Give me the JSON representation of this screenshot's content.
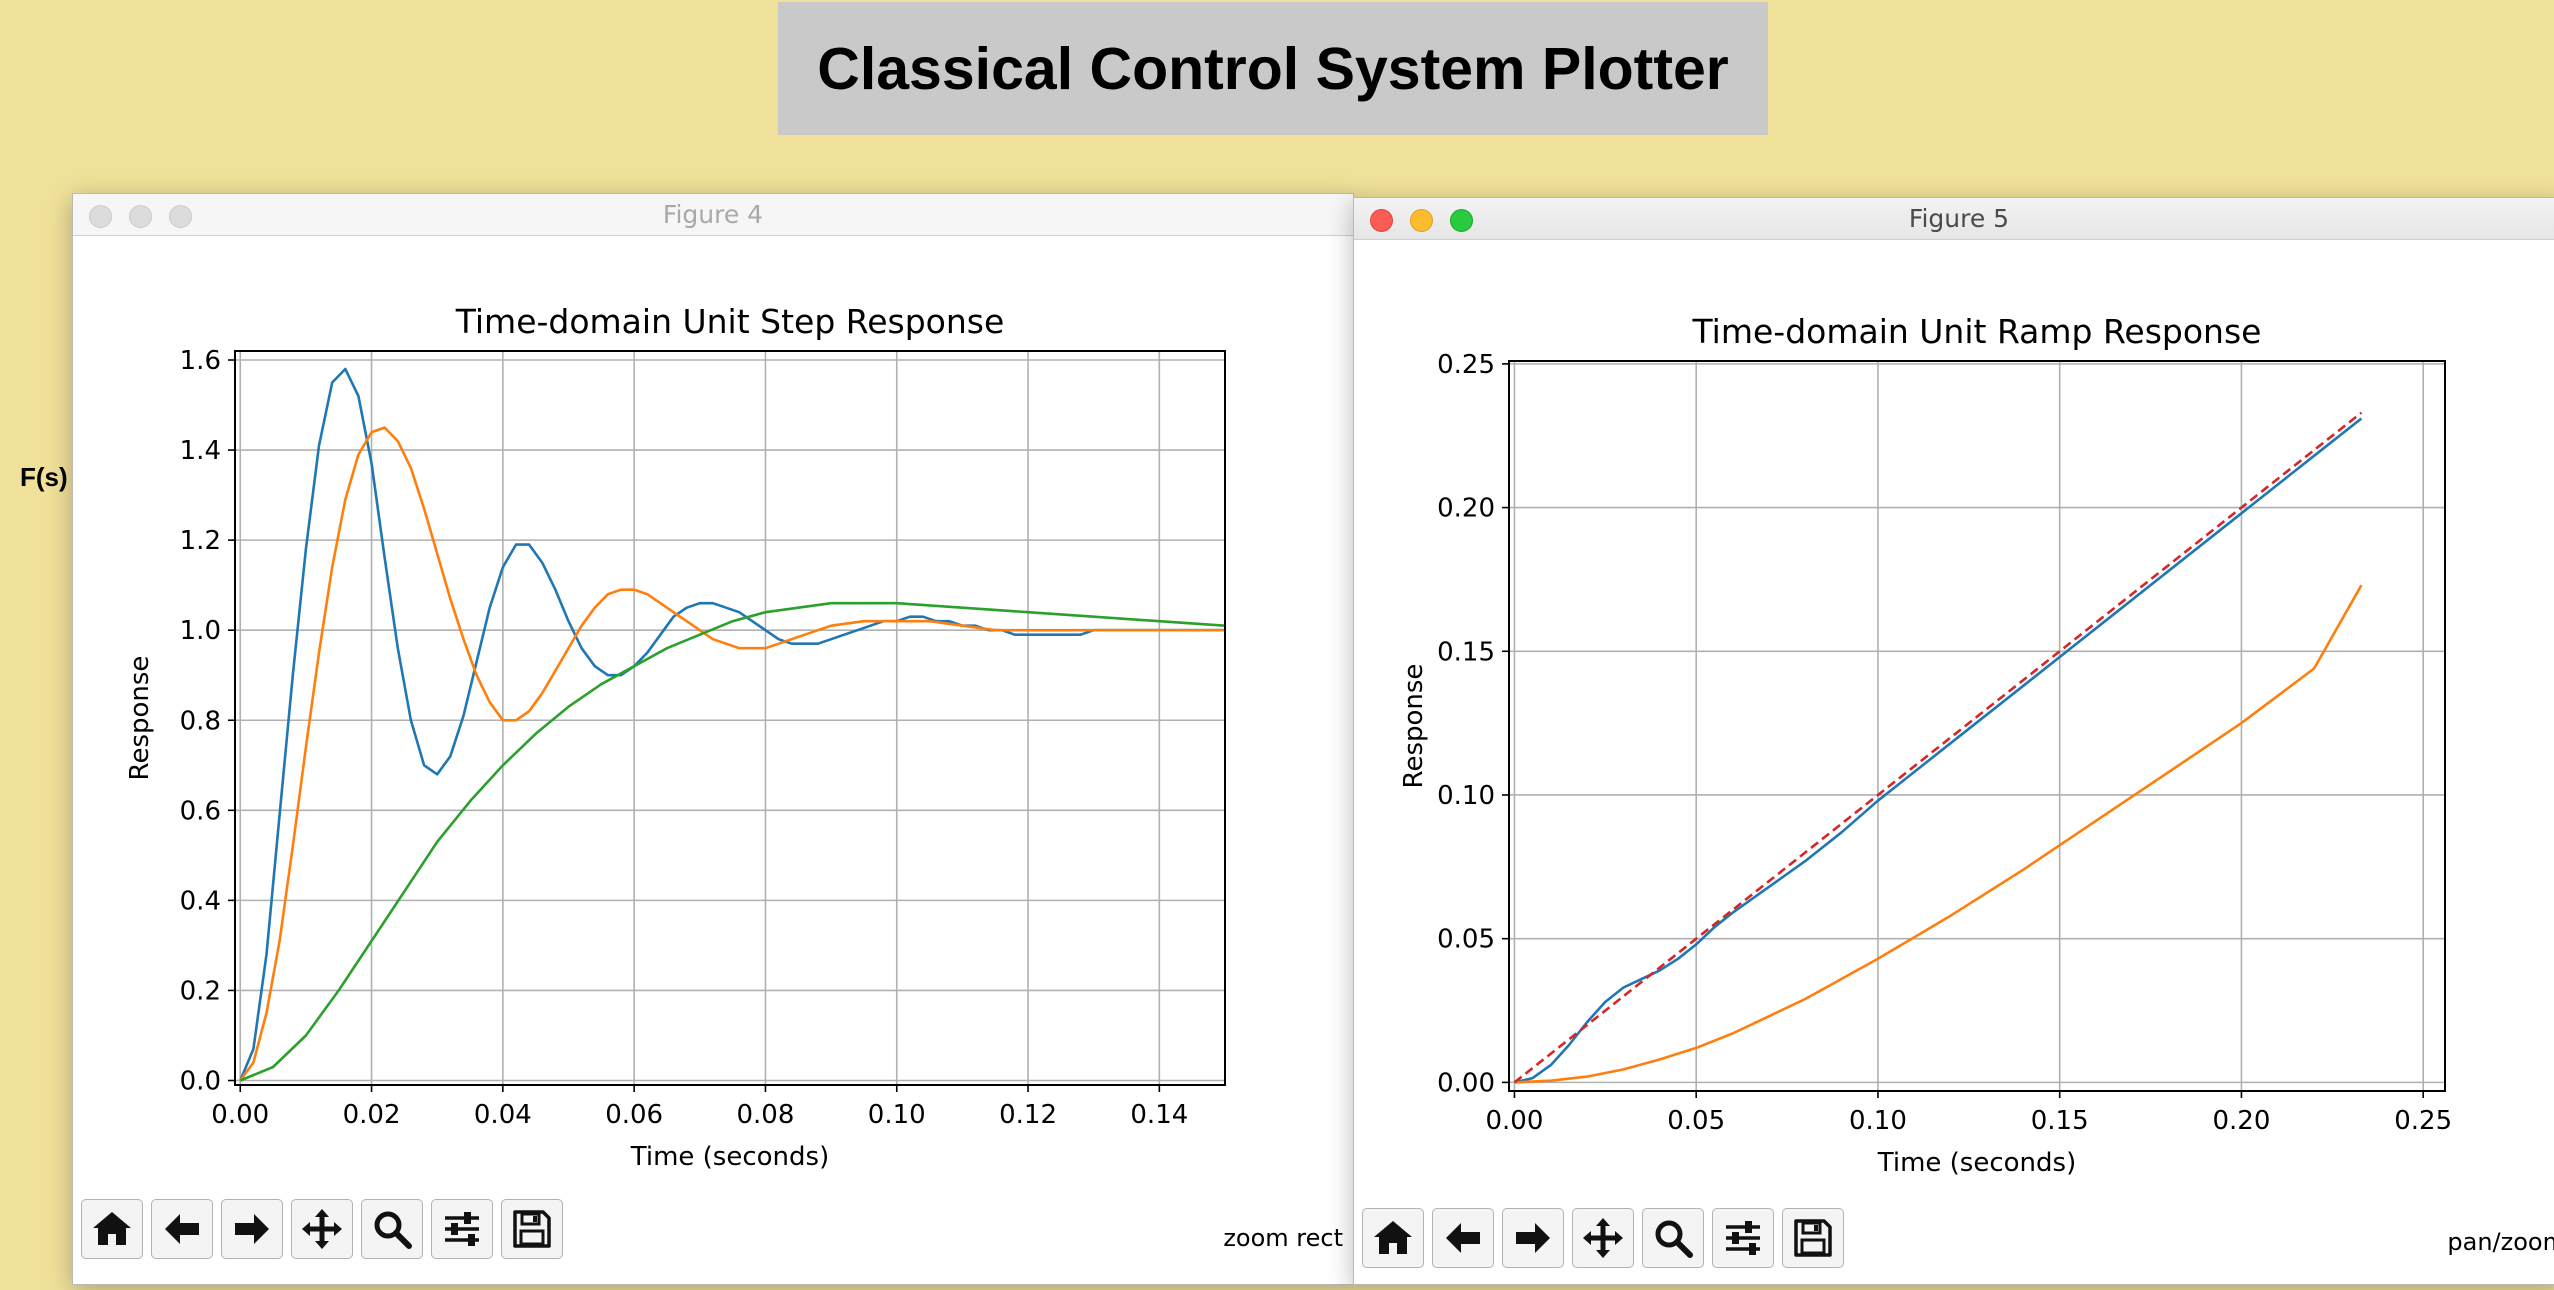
{
  "app": {
    "title": "Classical Control System Plotter",
    "side_label": "F(s)",
    "side_mark": "("
  },
  "figures": [
    {
      "window_title": "Figure 4",
      "mode_text": "zoom rect",
      "active": false
    },
    {
      "window_title": "Figure 5",
      "mode_text": "pan/zoom",
      "active": true
    }
  ],
  "toolbar": {
    "buttons": [
      {
        "name": "home-button",
        "icon": "home-icon"
      },
      {
        "name": "back-button",
        "icon": "arrow-left-icon"
      },
      {
        "name": "forward-button",
        "icon": "arrow-right-icon"
      },
      {
        "name": "pan-button",
        "icon": "move-arrows-icon"
      },
      {
        "name": "zoom-button",
        "icon": "magnifier-icon"
      },
      {
        "name": "configure-subplots-button",
        "icon": "sliders-icon"
      },
      {
        "name": "save-button",
        "icon": "floppy-disk-icon"
      }
    ]
  },
  "colors": {
    "series1": "#1f77b4",
    "series2": "#ff7f0e",
    "series3": "#2ca02c",
    "reference": "#d62728",
    "background": "#f0e19a"
  },
  "chart_data": [
    {
      "type": "line",
      "title": "Time-domain Unit Step Response",
      "xlabel": "Time (seconds)",
      "ylabel": "Response",
      "xlim": [
        -0.0008,
        0.15
      ],
      "ylim": [
        -0.01,
        1.62
      ],
      "xticks": [
        0.0,
        0.02,
        0.04,
        0.06,
        0.08,
        0.1,
        0.12,
        0.14
      ],
      "xtick_labels": [
        "0.00",
        "0.02",
        "0.04",
        "0.06",
        "0.08",
        "0.10",
        "0.12",
        "0.14"
      ],
      "yticks": [
        0.0,
        0.2,
        0.4,
        0.6,
        0.8,
        1.0,
        1.2,
        1.4,
        1.6
      ],
      "ytick_labels": [
        "0.0",
        "0.2",
        "0.4",
        "0.6",
        "0.8",
        "1.0",
        "1.2",
        "1.4",
        "1.6"
      ],
      "grid": true,
      "series": [
        {
          "color": "#1f77b4",
          "dashed": false,
          "x": [
            0,
            0.002,
            0.004,
            0.006,
            0.008,
            0.01,
            0.012,
            0.014,
            0.016,
            0.018,
            0.02,
            0.022,
            0.024,
            0.026,
            0.028,
            0.03,
            0.032,
            0.034,
            0.036,
            0.038,
            0.04,
            0.042,
            0.044,
            0.046,
            0.048,
            0.05,
            0.052,
            0.054,
            0.056,
            0.058,
            0.06,
            0.062,
            0.064,
            0.066,
            0.068,
            0.07,
            0.072,
            0.074,
            0.076,
            0.078,
            0.08,
            0.082,
            0.084,
            0.086,
            0.088,
            0.09,
            0.092,
            0.094,
            0.096,
            0.098,
            0.1,
            0.102,
            0.104,
            0.106,
            0.108,
            0.11,
            0.112,
            0.114,
            0.116,
            0.118,
            0.12,
            0.122,
            0.124,
            0.126,
            0.128,
            0.13,
            0.132,
            0.134,
            0.136,
            0.138,
            0.14,
            0.142,
            0.144,
            0.146,
            0.148,
            0.15
          ],
          "y": [
            0.0,
            0.07,
            0.28,
            0.59,
            0.9,
            1.18,
            1.41,
            1.55,
            1.58,
            1.52,
            1.37,
            1.16,
            0.96,
            0.8,
            0.7,
            0.68,
            0.72,
            0.81,
            0.93,
            1.05,
            1.14,
            1.19,
            1.19,
            1.15,
            1.09,
            1.02,
            0.96,
            0.92,
            0.9,
            0.9,
            0.92,
            0.95,
            0.99,
            1.03,
            1.05,
            1.06,
            1.06,
            1.05,
            1.04,
            1.02,
            1.0,
            0.98,
            0.97,
            0.97,
            0.97,
            0.98,
            0.99,
            1.0,
            1.01,
            1.02,
            1.02,
            1.03,
            1.03,
            1.02,
            1.02,
            1.01,
            1.01,
            1.0,
            1.0,
            0.99,
            0.99,
            0.99,
            0.99,
            0.99,
            0.99,
            1.0,
            1.0,
            1.0,
            1.0,
            1.0,
            1.0,
            1.0,
            1.0,
            1.0,
            1.0,
            1.0
          ]
        },
        {
          "color": "#ff7f0e",
          "dashed": false,
          "x": [
            0,
            0.002,
            0.004,
            0.006,
            0.008,
            0.01,
            0.012,
            0.014,
            0.016,
            0.018,
            0.02,
            0.022,
            0.024,
            0.026,
            0.028,
            0.03,
            0.032,
            0.034,
            0.036,
            0.038,
            0.04,
            0.042,
            0.044,
            0.046,
            0.048,
            0.05,
            0.052,
            0.054,
            0.056,
            0.058,
            0.06,
            0.062,
            0.064,
            0.066,
            0.068,
            0.07,
            0.072,
            0.074,
            0.076,
            0.078,
            0.08,
            0.082,
            0.084,
            0.086,
            0.088,
            0.09,
            0.095,
            0.1,
            0.105,
            0.11,
            0.115,
            0.12,
            0.125,
            0.13,
            0.135,
            0.14,
            0.145,
            0.15
          ],
          "y": [
            0.0,
            0.04,
            0.15,
            0.31,
            0.52,
            0.74,
            0.95,
            1.14,
            1.29,
            1.39,
            1.44,
            1.45,
            1.42,
            1.36,
            1.27,
            1.17,
            1.07,
            0.98,
            0.9,
            0.84,
            0.8,
            0.8,
            0.82,
            0.86,
            0.91,
            0.96,
            1.01,
            1.05,
            1.08,
            1.09,
            1.09,
            1.08,
            1.06,
            1.04,
            1.02,
            1.0,
            0.98,
            0.97,
            0.96,
            0.96,
            0.96,
            0.97,
            0.98,
            0.99,
            1.0,
            1.01,
            1.02,
            1.02,
            1.02,
            1.01,
            1.0,
            1.0,
            1.0,
            1.0,
            1.0,
            1.0,
            1.0,
            1.0
          ]
        },
        {
          "color": "#2ca02c",
          "dashed": false,
          "x": [
            0,
            0.005,
            0.01,
            0.015,
            0.02,
            0.025,
            0.03,
            0.035,
            0.04,
            0.045,
            0.05,
            0.055,
            0.06,
            0.065,
            0.07,
            0.075,
            0.08,
            0.085,
            0.09,
            0.095,
            0.1,
            0.11,
            0.12,
            0.13,
            0.14,
            0.15
          ],
          "y": [
            0.0,
            0.03,
            0.1,
            0.2,
            0.31,
            0.42,
            0.53,
            0.62,
            0.7,
            0.77,
            0.83,
            0.88,
            0.92,
            0.96,
            0.99,
            1.02,
            1.04,
            1.05,
            1.06,
            1.06,
            1.06,
            1.05,
            1.04,
            1.03,
            1.02,
            1.01
          ]
        }
      ]
    },
    {
      "type": "line",
      "title": "Time-domain Unit Ramp Response",
      "xlabel": "Time (seconds)",
      "ylabel": "Response",
      "xlim": [
        -0.0015,
        0.256
      ],
      "ylim": [
        -0.003,
        0.251
      ],
      "xticks": [
        0.0,
        0.05,
        0.1,
        0.15,
        0.2,
        0.25
      ],
      "xtick_labels": [
        "0.00",
        "0.05",
        "0.10",
        "0.15",
        "0.20",
        "0.25"
      ],
      "yticks": [
        0.0,
        0.05,
        0.1,
        0.15,
        0.2,
        0.25
      ],
      "ytick_labels": [
        "0.00",
        "0.05",
        "0.10",
        "0.15",
        "0.20",
        "0.25"
      ],
      "grid": true,
      "series": [
        {
          "color": "#1f77b4",
          "dashed": false,
          "x": [
            0,
            0.005,
            0.01,
            0.015,
            0.02,
            0.025,
            0.03,
            0.035,
            0.04,
            0.045,
            0.05,
            0.055,
            0.06,
            0.07,
            0.08,
            0.09,
            0.1,
            0.12,
            0.14,
            0.16,
            0.18,
            0.2,
            0.22,
            0.233
          ],
          "y": [
            0.0,
            0.0015,
            0.006,
            0.013,
            0.021,
            0.028,
            0.033,
            0.036,
            0.039,
            0.043,
            0.048,
            0.054,
            0.059,
            0.068,
            0.077,
            0.087,
            0.098,
            0.118,
            0.138,
            0.158,
            0.178,
            0.198,
            0.218,
            0.231
          ]
        },
        {
          "color": "#ff7f0e",
          "dashed": false,
          "x": [
            0,
            0.01,
            0.02,
            0.03,
            0.04,
            0.05,
            0.06,
            0.07,
            0.08,
            0.09,
            0.1,
            0.12,
            0.14,
            0.16,
            0.18,
            0.2,
            0.22,
            0.233
          ],
          "y": [
            0.0,
            0.0006,
            0.002,
            0.0045,
            0.008,
            0.012,
            0.017,
            0.023,
            0.029,
            0.036,
            0.043,
            0.058,
            0.074,
            0.091,
            0.108,
            0.125,
            0.144,
            0.173
          ]
        },
        {
          "color": "#d62728",
          "dashed": true,
          "x": [
            0,
            0.233
          ],
          "y": [
            0.0,
            0.233
          ]
        }
      ]
    }
  ]
}
